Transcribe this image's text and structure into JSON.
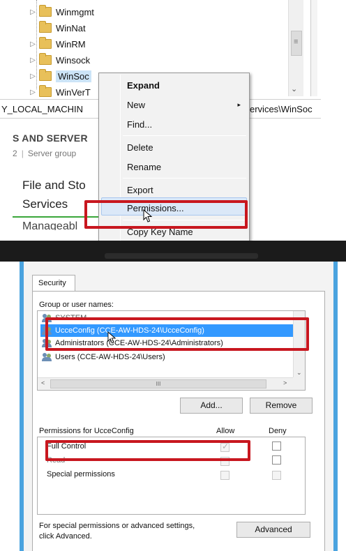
{
  "registry": {
    "tree_items": [
      {
        "label": "Winmgmt",
        "expander": "▷"
      },
      {
        "label": "WinNat",
        "expander": ""
      },
      {
        "label": "WinRM",
        "expander": "▷"
      },
      {
        "label": "Winsock",
        "expander": "▷"
      },
      {
        "label": "WinSoc",
        "expander": "▷"
      },
      {
        "label": "WinVerT",
        "expander": "▷"
      }
    ],
    "path_left": "Y_LOCAL_MACHIN",
    "path_right": "ervices\\WinSoc",
    "scroll_down_glyph": "⌄"
  },
  "server_manager": {
    "title": "S AND SERVER",
    "subtitle_num": "2",
    "subtitle_text": "Server group",
    "role_line1": "File and Sto",
    "role_line2": "Services",
    "manage_text": "Manageabl"
  },
  "context_menu": {
    "items": {
      "expand": "Expand",
      "new": "New",
      "find": "Find...",
      "delete": "Delete",
      "rename": "Rename",
      "export": "Export",
      "permissions": "Permissions...",
      "copy_key_name": "Copy Key Name"
    },
    "submenu_arrow": "▸"
  },
  "dialog": {
    "tab_security": "Security",
    "group_label": "Group or user names:",
    "users": [
      {
        "name": "SYSTEM",
        "selected": false
      },
      {
        "name": "UcceConfig (CCE-AW-HDS-24\\UcceConfig)",
        "selected": true
      },
      {
        "name": "Administrators (CCE-AW-HDS-24\\Administrators)",
        "selected": false
      },
      {
        "name": "Users (CCE-AW-HDS-24\\Users)",
        "selected": false
      }
    ],
    "scroll_thumb_glyph": "III",
    "scroll_left": "<",
    "scroll_right": ">",
    "scroll_down": "⌄",
    "add_button": "Add...",
    "remove_button": "Remove",
    "permissions_for": "Permissions for UcceConfig",
    "allow_header": "Allow",
    "deny_header": "Deny",
    "permissions": [
      {
        "name": "Full Control",
        "allow": true,
        "deny": false
      },
      {
        "name": "Read",
        "allow": false,
        "deny": false
      },
      {
        "name": "Special permissions",
        "allow": false,
        "deny": false
      }
    ],
    "advanced_note_line1": "For special permissions or advanced settings,",
    "advanced_note_line2": "click Advanced.",
    "advanced_button": "Advanced"
  },
  "colors": {
    "highlight_red": "#c8171f",
    "selection_blue": "#3399ff",
    "window_border_blue": "#4aa3df"
  }
}
